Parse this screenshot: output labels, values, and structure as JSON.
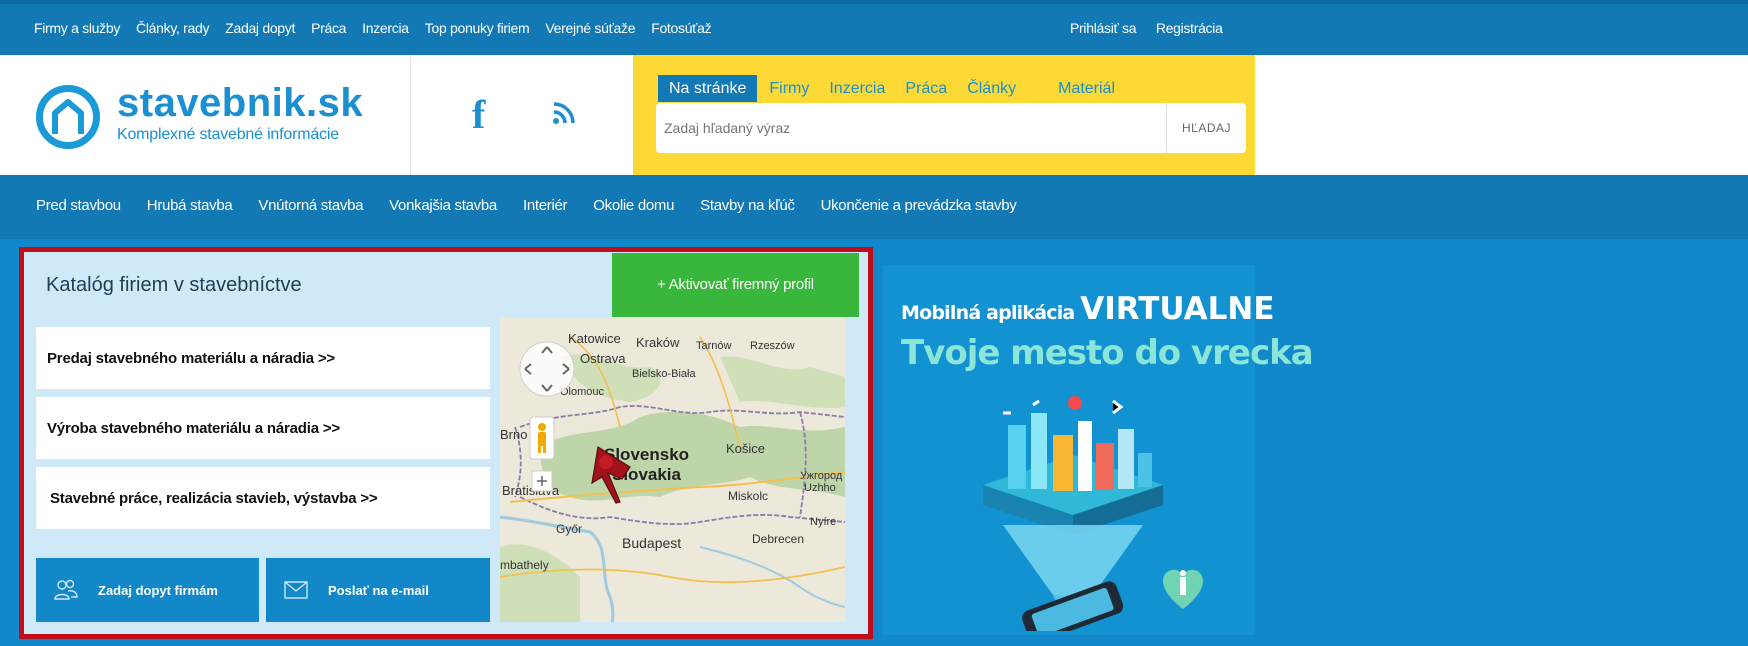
{
  "topbar": {
    "links": [
      "Firmy a služby",
      "Články, rady",
      "Zadaj dopyt",
      "Práca",
      "Inzercia",
      "Top ponuky firiem",
      "Verejné súťaže",
      "Fotosúťaž"
    ],
    "login": "Prihlásiť sa",
    "register": "Registrácia"
  },
  "header": {
    "logo_text": "stavebnik.sk",
    "logo_sub": "Komplexné stavebné informácie",
    "icons": [
      "home-logo-icon",
      "facebook-icon",
      "rss-icon"
    ]
  },
  "search": {
    "tabs": [
      "Na stránke",
      "Firmy",
      "Inzercia",
      "Práca",
      "Články",
      "Materiál"
    ],
    "active_tab": "Na stránke",
    "placeholder": "Zadaj hľadaný výraz",
    "button": "HĽADAJ"
  },
  "catnav": {
    "items": [
      "Pred stavbou",
      "Hrubá stavba",
      "Vnútorná stavba",
      "Vonkajšia stavba",
      "Interiér",
      "Okolie domu",
      "Stavby na kľúč",
      "Ukončenie a prevádzka stavby"
    ]
  },
  "catalog": {
    "title": "Katalóg firiem v stavebníctve",
    "activate": "+ Aktivovať firemný profil",
    "links": [
      "Predaj stavebného materiálu a náradia >>",
      "Výroba stavebného materiálu a náradia >>",
      "Stavebné práce, realizácia stavieb, výstavba >>"
    ],
    "demand_button": "Zadaj dopyt firmám",
    "email_button": "Poslať na e-mail",
    "map_labels": {
      "katowice": "Katowice",
      "krakow": "Kraków",
      "tarnow": "Tarnów",
      "rzeszow": "Rzeszów",
      "ostrava": "Ostrava",
      "bielsko": "Bielsko-Biała",
      "olomouc": "Olomouc",
      "brno": "Brno",
      "slovensko": "Slovensko",
      "slovakia": "Slovakia",
      "kosice": "Košice",
      "uzhhorod": "Ужгород",
      "uzhhorod2": "Uzhho",
      "bratislava": "Bratislava",
      "miskolc": "Miskolc",
      "nyire": "Nyíre",
      "gyor": "Győr",
      "budapest": "Budapest",
      "debrecen": "Debrecen",
      "szombathely": "mbathely"
    }
  },
  "ad": {
    "line1_a": "Mobilná aplikácia",
    "line1_b": "VIRTUALNE",
    "line2": "Tvoje mesto do vrecka"
  },
  "colors": {
    "primary_blue": "#1279b4",
    "bright_blue": "#1b8fd0",
    "search_yellow": "#fcd935",
    "green": "#39b63c",
    "highlight_red": "#c00d1a"
  }
}
